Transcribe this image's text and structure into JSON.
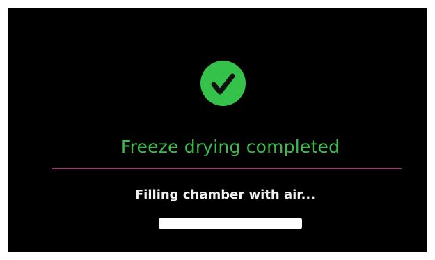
{
  "status": {
    "icon": "checkmark-icon",
    "title": "Freeze drying completed",
    "message": "Filling chamber with air...",
    "progress": 1.0
  },
  "colors": {
    "background": "#000000",
    "success": "#35c24a",
    "title": "#3dbb4f",
    "divider": "#9a3a73",
    "message": "#f2f2f2",
    "progress": "#ffffff"
  }
}
